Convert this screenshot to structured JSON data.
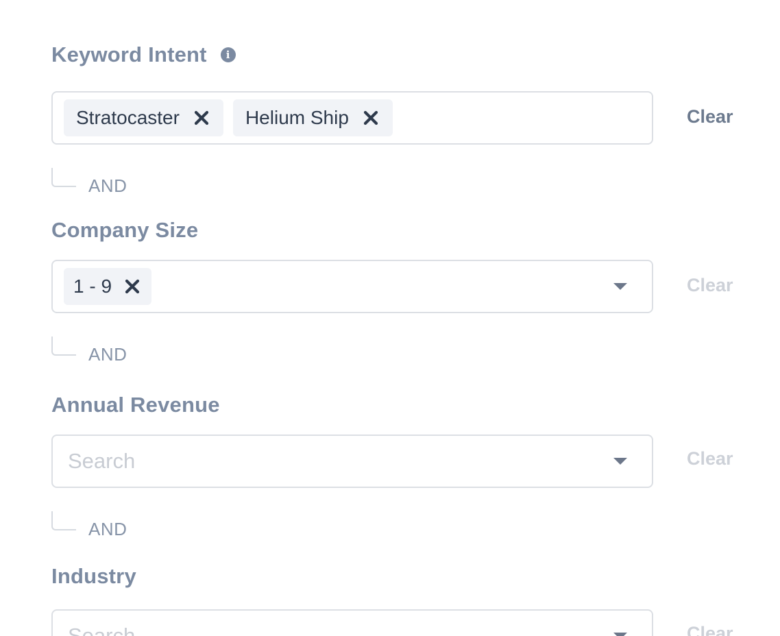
{
  "filters": [
    {
      "label": "Keyword Intent",
      "has_info_icon": true,
      "chips": [
        "Stratocaster",
        "Helium Ship"
      ],
      "placeholder": "",
      "has_dropdown": false,
      "clear_label": "Clear",
      "clear_state": "active"
    },
    {
      "label": "Company Size",
      "has_info_icon": false,
      "chips": [
        "1 - 9"
      ],
      "placeholder": "",
      "has_dropdown": true,
      "clear_label": "Clear",
      "clear_state": "inactive"
    },
    {
      "label": "Annual Revenue",
      "has_info_icon": false,
      "chips": [],
      "placeholder": "Search",
      "has_dropdown": true,
      "clear_label": "Clear",
      "clear_state": "inactive"
    },
    {
      "label": "Industry",
      "has_info_icon": false,
      "chips": [],
      "placeholder": "Search",
      "has_dropdown": true,
      "clear_label": "Clear",
      "clear_state": "inactive"
    }
  ],
  "connector_label": "AND",
  "info_icon_glyph": "i",
  "icons": {
    "info": "info-icon",
    "remove": "x-icon",
    "dropdown": "caret-down-icon"
  },
  "colors": {
    "label": "#7b8aa1",
    "chip_bg": "#f1f3f7",
    "chip_text": "#2e3a4c",
    "border": "#dcdfe4",
    "clear_active": "#6c7a8e",
    "clear_inactive": "#cdd1d8"
  }
}
